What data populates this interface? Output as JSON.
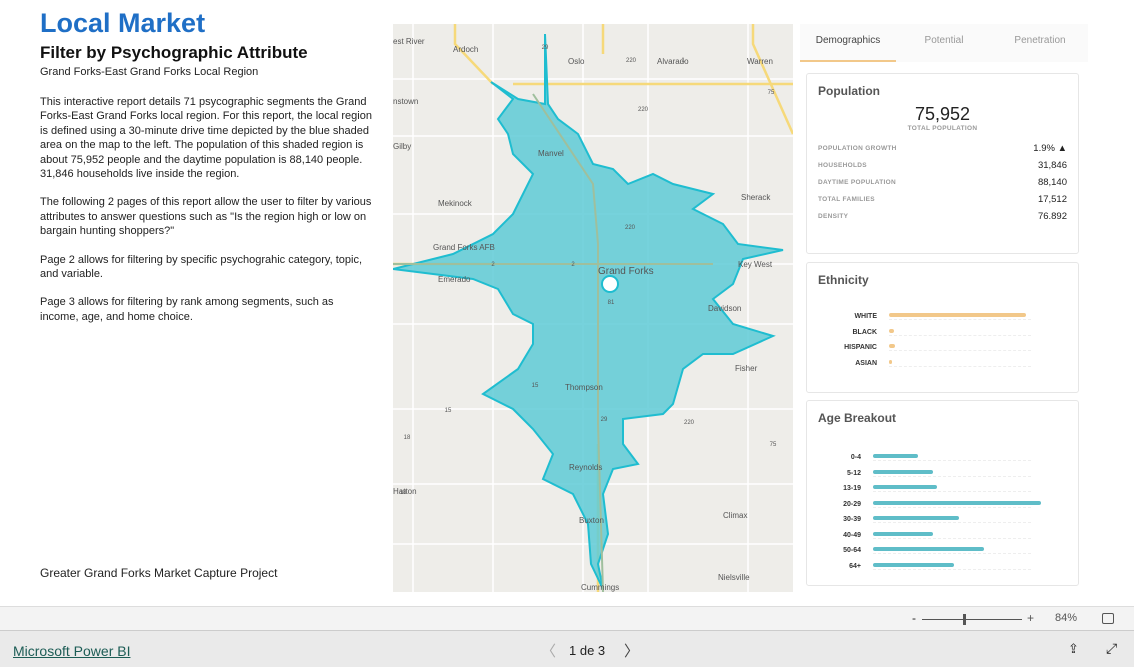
{
  "header": {
    "title": "Local Market",
    "subtitle": "Filter by Psychographic Attribute",
    "region": "Grand Forks-East Grand Forks Local Region"
  },
  "paragraphs": [
    "This interactive report details 71 psycographic segments the Grand Forks-East Grand Forks local region. For this report, the local region is defined using a 30-minute drive time depicted by the blue shaded area on the map to the left. The population of this shaded region is about 75,952 people and the daytime population is 88,140 people. 31,846 households live inside the region.",
    "The following 2 pages of this report allow the user to filter by various attributes to answer questions such as \"Is the region high or low on bargain hunting shoppers?\"",
    "Page 2 allows for filtering by specific psychograhic category, topic, and variable.",
    "Page 3 allows for filtering by rank among segments, such as income, age, and home choice."
  ],
  "footer_note": "Greater Grand Forks Market Capture Project",
  "map": {
    "labels": [
      "est River",
      "Ardoch",
      "Oslo",
      "Alvarado",
      "Warren",
      "nstown",
      "Gilby",
      "Manvel",
      "Mekinock",
      "Sherack",
      "Grand Forks AFB",
      "Emerado",
      "Grand Forks",
      "Key West",
      "Davidson",
      "Fisher",
      "Thompson",
      "Reynolds",
      "Hatton",
      "Climax",
      "Buxton",
      "Nielsville",
      "Cummings"
    ],
    "shields": [
      "29",
      "220",
      "1",
      "75",
      "220",
      "2",
      "2",
      "220",
      "81",
      "15",
      "15",
      "18",
      "18",
      "220",
      "75",
      "29"
    ],
    "region_color": "#5ecad6"
  },
  "tabs": [
    "Demographics",
    "Potential",
    "Penetration"
  ],
  "population": {
    "title": "Population",
    "total": "75,952",
    "total_label": "TOTAL POPULATION",
    "stats": [
      {
        "k": "POPULATION GROWTH",
        "v": "1.9% ▲"
      },
      {
        "k": "HOUSEHOLDS",
        "v": "31,846"
      },
      {
        "k": "DAYTIME POPULATION",
        "v": "88,140"
      },
      {
        "k": "TOTAL FAMILIES",
        "v": "17,512"
      },
      {
        "k": "DENSITY",
        "v": "76.892"
      }
    ]
  },
  "ethnicity": {
    "title": "Ethnicity",
    "color": "#f2c88a",
    "items": [
      {
        "label": "WHITE",
        "value": 0.91
      },
      {
        "label": "BLACK",
        "value": 0.03
      },
      {
        "label": "HISPANIC",
        "value": 0.04
      },
      {
        "label": "ASIAN",
        "value": 0.02
      }
    ]
  },
  "age": {
    "title": "Age Breakout",
    "color": "#5fbdc8",
    "items": [
      {
        "label": "0-4",
        "value": 0.27
      },
      {
        "label": "5-12",
        "value": 0.36
      },
      {
        "label": "13-19",
        "value": 0.38
      },
      {
        "label": "20-29",
        "value": 1.0
      },
      {
        "label": "30-39",
        "value": 0.51
      },
      {
        "label": "40-49",
        "value": 0.36
      },
      {
        "label": "50-64",
        "value": 0.66
      },
      {
        "label": "64+",
        "value": 0.48
      }
    ]
  },
  "zoom": {
    "minus": "-",
    "plus": "+",
    "level": "84%",
    "slider": 0.45
  },
  "bottom": {
    "brand": "Microsoft Power BI",
    "page": "1 de 3"
  }
}
